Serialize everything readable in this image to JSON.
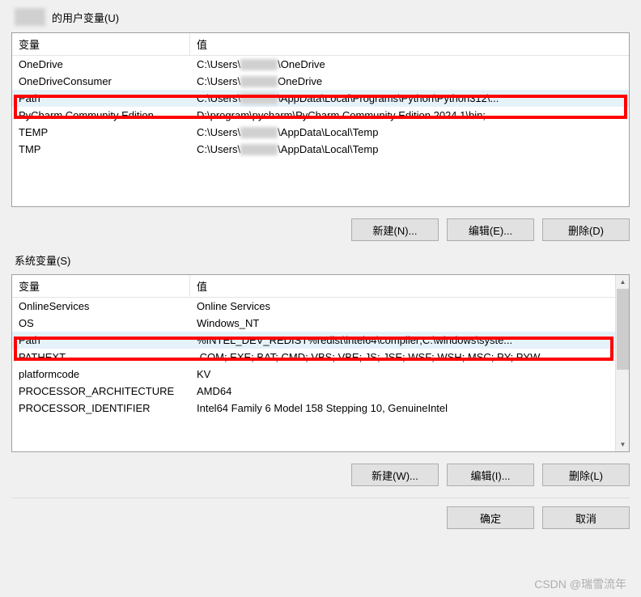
{
  "user": {
    "title_suffix": "的用户变量(U)",
    "headers": {
      "var": "变量",
      "val": "值"
    },
    "rows": [
      {
        "var": "OneDrive",
        "val_prefix": "C:\\Users\\",
        "val_suffix": "\\OneDrive"
      },
      {
        "var": "OneDriveConsumer",
        "val_prefix": "C:\\Users\\",
        "val_suffix": "OneDrive"
      },
      {
        "var": "Path",
        "val_prefix": "C:\\Users\\",
        "val_suffix": "\\AppData\\Local\\Programs\\Python\\Python312\\...",
        "selected": true
      },
      {
        "var": "PyCharm Community Edition",
        "val_prefix": "D:\\program\\pycharm\\PyCharm Community Edition 2024.1\\bin;",
        "val_suffix": ""
      },
      {
        "var": "TEMP",
        "val_prefix": "C:\\Users\\",
        "val_suffix": "\\AppData\\Local\\Temp"
      },
      {
        "var": "TMP",
        "val_prefix": "C:\\Users\\",
        "val_suffix": "\\AppData\\Local\\Temp"
      }
    ],
    "buttons": {
      "new": "新建(N)...",
      "edit": "编辑(E)...",
      "delete": "删除(D)"
    }
  },
  "system": {
    "title": "系统变量(S)",
    "headers": {
      "var": "变量",
      "val": "值"
    },
    "rows": [
      {
        "var": "OnlineServices",
        "val": "Online Services"
      },
      {
        "var": "OS",
        "val": "Windows_NT"
      },
      {
        "var": "Path",
        "val": "%INTEL_DEV_REDIST%redist\\intel64\\compiler;C:\\windows\\syste...",
        "selected": true
      },
      {
        "var": "PATHEXT",
        "val": ".COM;.EXE;.BAT;.CMD;.VBS;.VBE;.JS;.JSE;.WSF;.WSH;.MSC;.PY;.PYW"
      },
      {
        "var": "platformcode",
        "val": "KV"
      },
      {
        "var": "PROCESSOR_ARCHITECTURE",
        "val": "AMD64"
      },
      {
        "var": "PROCESSOR_IDENTIFIER",
        "val": "Intel64 Family 6 Model 158 Stepping 10, GenuineIntel"
      }
    ],
    "buttons": {
      "new": "新建(W)...",
      "edit": "编辑(I)...",
      "delete": "删除(L)"
    }
  },
  "footer": {
    "ok": "确定",
    "cancel": "取消"
  },
  "watermark": "CSDN @瑞雪流年"
}
